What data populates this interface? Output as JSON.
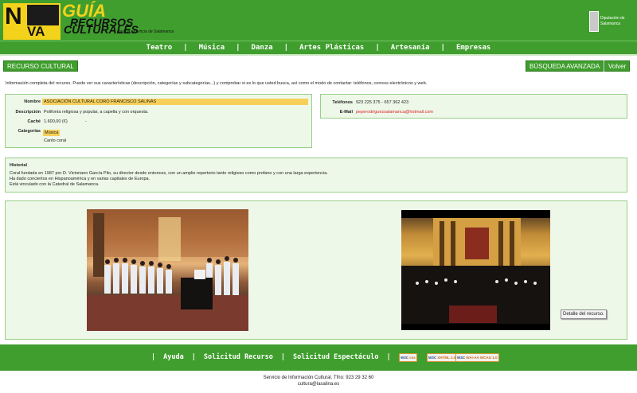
{
  "header": {
    "logo": {
      "n": "N",
      "va": "VA",
      "guia": "GUÍA",
      "recursos": "RECURSOS",
      "culturales": "CULTURALES",
      "tagline": "para la provincia de Salamanca"
    },
    "diputacion": "Diputación de Salamanca"
  },
  "nav": {
    "items": [
      "Teatro",
      "Música",
      "Danza",
      "Artes Plásticas",
      "Artesanía",
      "Empresas"
    ]
  },
  "buttons": {
    "recurso_cultural": "RECURSO CULTURAL",
    "busqueda": "BÚSQUEDA AVANZADA",
    "volver": "Volver"
  },
  "intro": "Información completa del recurso. Puede ver sus características (descripción, categorías y subcategorías...) y comprobar si es lo que usted busca, así como el modo de contactar: teléfonos, correos electrónicos y web.",
  "resource": {
    "nombre_label": "Nombre",
    "nombre": "ASOCIACIÓN CULTURAL CORO FRANCISCO SALINAS",
    "descripcion_label": "Descripción",
    "descripcion": "Polifonía religiosa y popular, a capella y con orquesta.",
    "cache_label": "Caché",
    "cache": "1.600,00 (€)",
    "cache_dash": "-",
    "categorias_label": "Categorías",
    "categoria": "Música",
    "subcategoria": "Canto coral"
  },
  "contact": {
    "telefonos_label": "Teléfonos",
    "telefonos": "923 225 375 - 657 362 423",
    "email_label": "E-Mail",
    "email": "peperodriguezsalamanca@hotmail.com"
  },
  "historial": {
    "title": "Historial",
    "lines": [
      "Coral fundada en 1987 por D. Victoriano García Pilo, su director desde entonces, con un amplio repertorio tanto religioso como profano y con una larga experiencia.",
      "Ha dado conciertos en Hispanoamérica y en varias capitales de Europa.",
      "Está vinculado con la Catedral de Salamanca."
    ]
  },
  "tooltip": "Detalle del recurso.",
  "footer": {
    "links": [
      "Ayuda",
      "Solicitud Recurso",
      "Solicitud Espectáculo"
    ],
    "badges": [
      {
        "left": "W3C",
        "right": "css"
      },
      {
        "left": "W3C",
        "right": "XHTML 1.0"
      },
      {
        "left": "W3C",
        "right": "WAI-AA WCAG 1.0"
      }
    ],
    "servicio": "Servicio de Información Cultural. Tfno: 923 29 32 60",
    "email": "cultura@lasalina.es"
  }
}
